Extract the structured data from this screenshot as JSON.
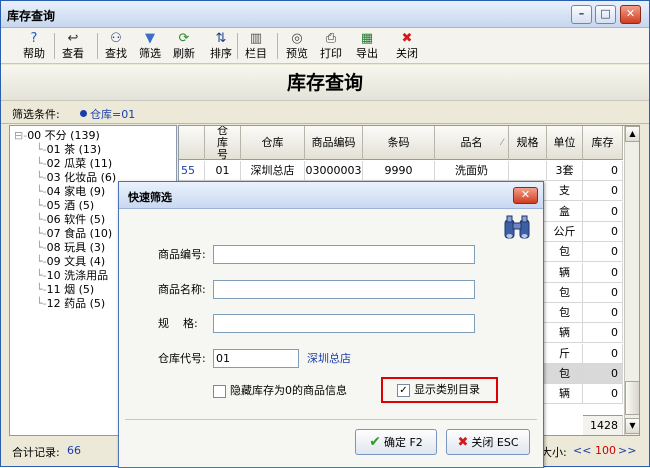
{
  "window": {
    "title": "库存查询",
    "btn_min": "–",
    "btn_max": "□",
    "btn_close": "✕"
  },
  "toolbar": [
    {
      "label": "帮助",
      "icon": "help-icon",
      "glyph": "?",
      "color": "#1c5fc4"
    },
    {
      "label": "查看",
      "icon": "view-icon",
      "glyph": "↩",
      "color": "#333333"
    },
    {
      "label": "查找",
      "icon": "binoculars-icon",
      "glyph": "⚇",
      "color": "#243f7a"
    },
    {
      "label": "筛选",
      "icon": "filter-icon",
      "glyph": "▼",
      "color": "#3a6fc9"
    },
    {
      "label": "刷新",
      "icon": "refresh-icon",
      "glyph": "⟳",
      "color": "#2e8b2e"
    },
    {
      "label": "排序",
      "icon": "sort-icon",
      "glyph": "⇅",
      "color": "#1c3f8a"
    },
    {
      "label": "栏目",
      "icon": "columns-icon",
      "glyph": "▥",
      "color": "#555555"
    },
    {
      "label": "预览",
      "icon": "preview-icon",
      "glyph": "◎",
      "color": "#4a4a4a"
    },
    {
      "label": "打印",
      "icon": "print-icon",
      "glyph": "⎙",
      "color": "#333333"
    },
    {
      "label": "导出",
      "icon": "excel-icon",
      "glyph": "▦",
      "color": "#1e7a2c"
    },
    {
      "label": "关闭",
      "icon": "close-icon",
      "glyph": "✖",
      "color": "#d01c1c"
    }
  ],
  "banner": {
    "title": "库存查询"
  },
  "filter": {
    "label": "筛选条件:",
    "value": "仓库=01"
  },
  "tree": [
    {
      "text": "00 不分 (139)",
      "prefix": "⊟-"
    },
    {
      "text": "01 茶 (13)"
    },
    {
      "text": "02 瓜菜 (11)"
    },
    {
      "text": "03 化妆品 (6)"
    },
    {
      "text": "04 家电 (9)"
    },
    {
      "text": "05 酒 (5)"
    },
    {
      "text": "06 软件 (5)"
    },
    {
      "text": "07 食品 (10)"
    },
    {
      "text": "08 玩具 (3)"
    },
    {
      "text": "09 文具 (4)"
    },
    {
      "text": "10 洗涤用品"
    },
    {
      "text": "11 烟 (5)"
    },
    {
      "text": "12 药品 (5)"
    }
  ],
  "grid": {
    "headers": [
      "仓库号",
      "仓库",
      "商品编码",
      "条码",
      "品名",
      "规格",
      "单位",
      "库存"
    ],
    "sort_mark": "⁄",
    "first_row": {
      "num": "55",
      "cells": [
        "01",
        "深圳总店",
        "03000003",
        "9990",
        "洗面奶",
        "",
        "3套",
        "0"
      ]
    },
    "units": [
      "支",
      "盒",
      "公斤",
      "包",
      "辆",
      "包",
      "包",
      "辆",
      "斤",
      "包",
      "辆"
    ],
    "stocks": [
      "0",
      "0",
      "0",
      "0",
      "0",
      "0",
      "0",
      "0",
      "0",
      "0",
      "0"
    ],
    "total": "1428"
  },
  "status": {
    "record_label": "合计记录:",
    "record_value": "66",
    "page_label": "大小:",
    "page_prev": "<<",
    "page_size": "100",
    "page_next": ">>"
  },
  "dialog": {
    "title": "快速筛选",
    "close": "✕",
    "fields": {
      "code_label": "商品编号:",
      "code_value": "",
      "name_label": "商品名称:",
      "name_value": "",
      "spec_label": "规    格:",
      "spec_value": "",
      "wh_label": "仓库代号:",
      "wh_value": "01",
      "wh_name": "深圳总店"
    },
    "hide_zero": "隐藏库存为0的商品信息",
    "show_category": "显示类别目录",
    "show_category_checked": "✓",
    "ok": "确定 F2",
    "cancel": "关闭 ESC",
    "ok_icon": "✔",
    "cancel_icon": "✖"
  }
}
